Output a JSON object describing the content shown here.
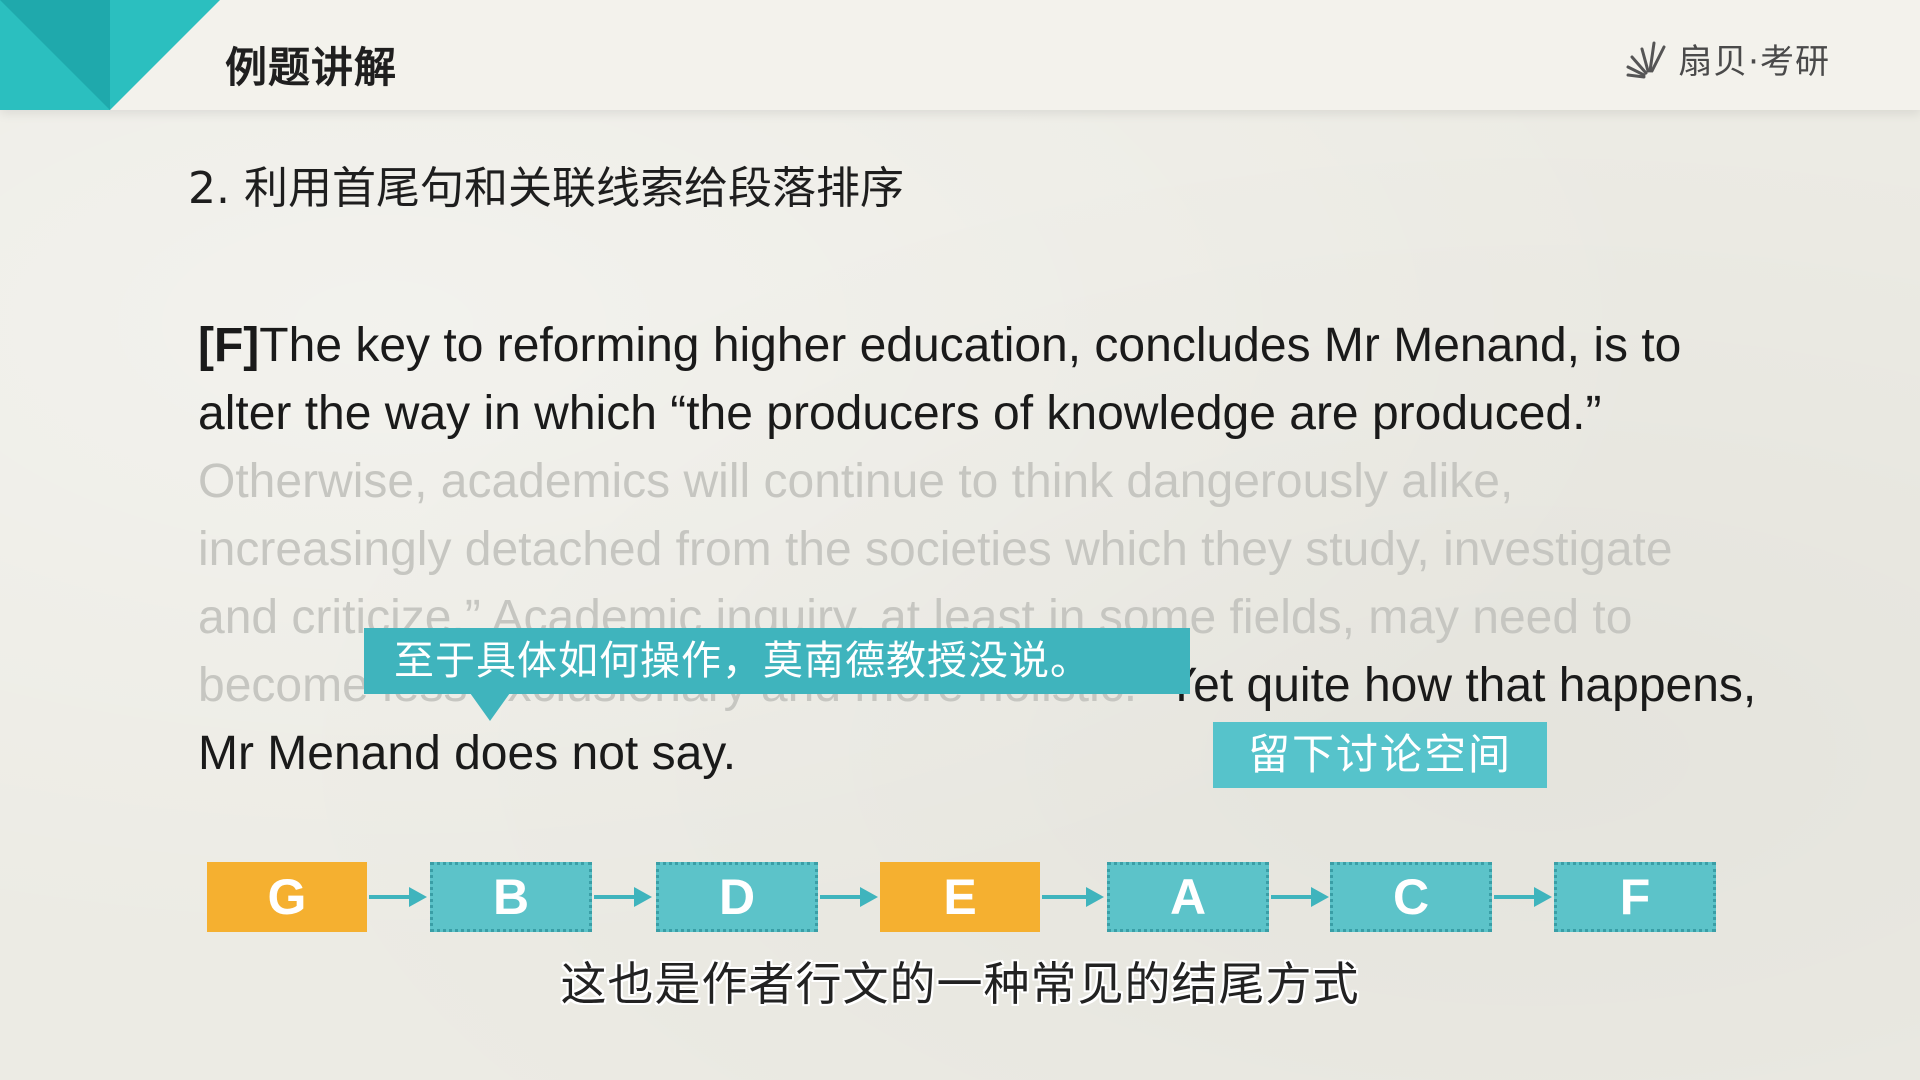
{
  "header": {
    "title": "例题讲解",
    "brand": "扇贝·考研",
    "accent_color": "#2bbfbf"
  },
  "section_title": "2. 利用首尾句和关联线索给段落排序",
  "passage": {
    "label": "[F]",
    "text1": "The key to reforming higher education, concludes Mr Menand, is to alter the way in which “the producers of knowledge are produced.” ",
    "faded": "Otherwise, academics will continue to think dangerously alike, increasingly detached from the societies which they study, investigate and criticize.” Academic inquiry, at least in some fields, may need to become less exclusionary and more holistic.”",
    "text2": "Yet quite how that happens, Mr Menand does not say."
  },
  "callout": "至于具体如何操作，莫南德教授没说。",
  "tag": "留下讨论空间",
  "sequence": [
    {
      "letter": "G",
      "color": "orange"
    },
    {
      "letter": "B",
      "color": "teal"
    },
    {
      "letter": "D",
      "color": "teal"
    },
    {
      "letter": "E",
      "color": "orange"
    },
    {
      "letter": "A",
      "color": "teal"
    },
    {
      "letter": "C",
      "color": "teal"
    },
    {
      "letter": "F",
      "color": "teal"
    }
  ],
  "subtitle": "这也是作者行文的一种常见的结尾方式",
  "colors": {
    "orange": "#f5b030",
    "teal": "#5cc3c9",
    "callout": "#3fb4bd"
  }
}
